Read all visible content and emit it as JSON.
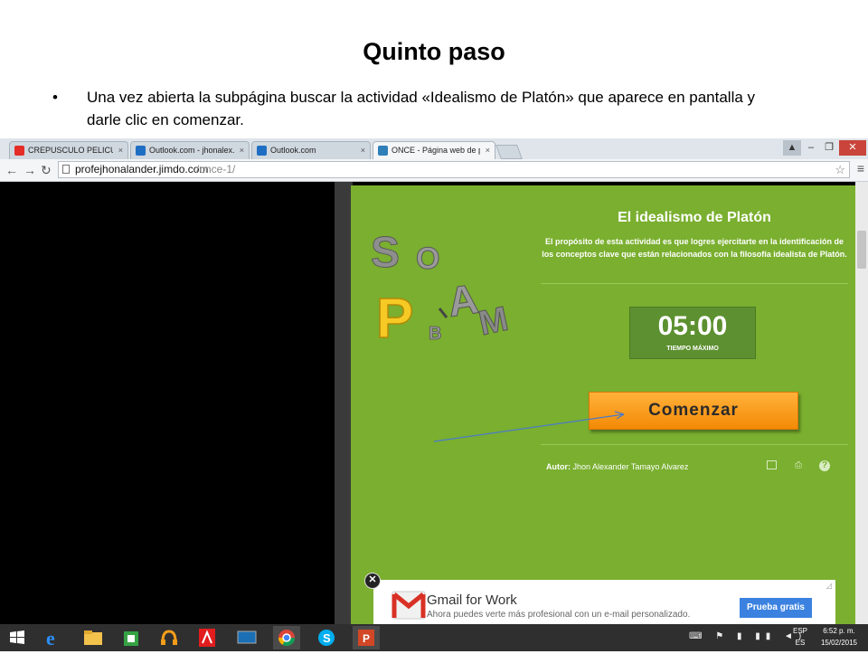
{
  "slide": {
    "title": "Quinto paso",
    "bullet": "Una vez abierta la subpágina buscar la actividad «Idealismo de Platón» que aparece en pantalla y darle clic en comenzar."
  },
  "browser": {
    "tabs": [
      {
        "label": "CREPUSCULO PELICULA C",
        "icon": "youtube-icon",
        "active": false
      },
      {
        "label": "Outlook.com - jhonalex.ta",
        "icon": "outlook-icon",
        "active": false
      },
      {
        "label": "Outlook.com",
        "icon": "outlook-icon",
        "active": false
      },
      {
        "label": "ONCE - Página web de pr",
        "icon": "jimdo-icon",
        "active": true
      }
    ],
    "url_host": "profejhonalander.jimdo.com",
    "url_path": "/once-1/"
  },
  "activity": {
    "title": "El idealismo de Platón",
    "description": "El propósito de esta actividad es que logres ejercitarte en la identificación de los conceptos clave que están relacionados con la filosofía idealista de Platón.",
    "timer_value": "05:00",
    "timer_label": "TIEMPO MÁXIMO",
    "start_label": "Comenzar",
    "author_label": "Autor:",
    "author_name": "Jhon Alexander Tamayo Alvarez",
    "logo_letters": [
      "S",
      "O",
      "A",
      "M",
      "P",
      "B"
    ]
  },
  "ad": {
    "title": "Gmail for Work",
    "text": "Ahora puedes verte más profesional con un e-mail personalizado.",
    "button": "Prueba gratis"
  },
  "taskbar": {
    "lang_top": "ESP",
    "lang_bottom": "ES",
    "time": "6:52 p. m.",
    "date": "15/02/2015"
  },
  "colors": {
    "green": "#7aaf2f",
    "orange": "#f48a06",
    "timer_bg": "#5d9030"
  }
}
